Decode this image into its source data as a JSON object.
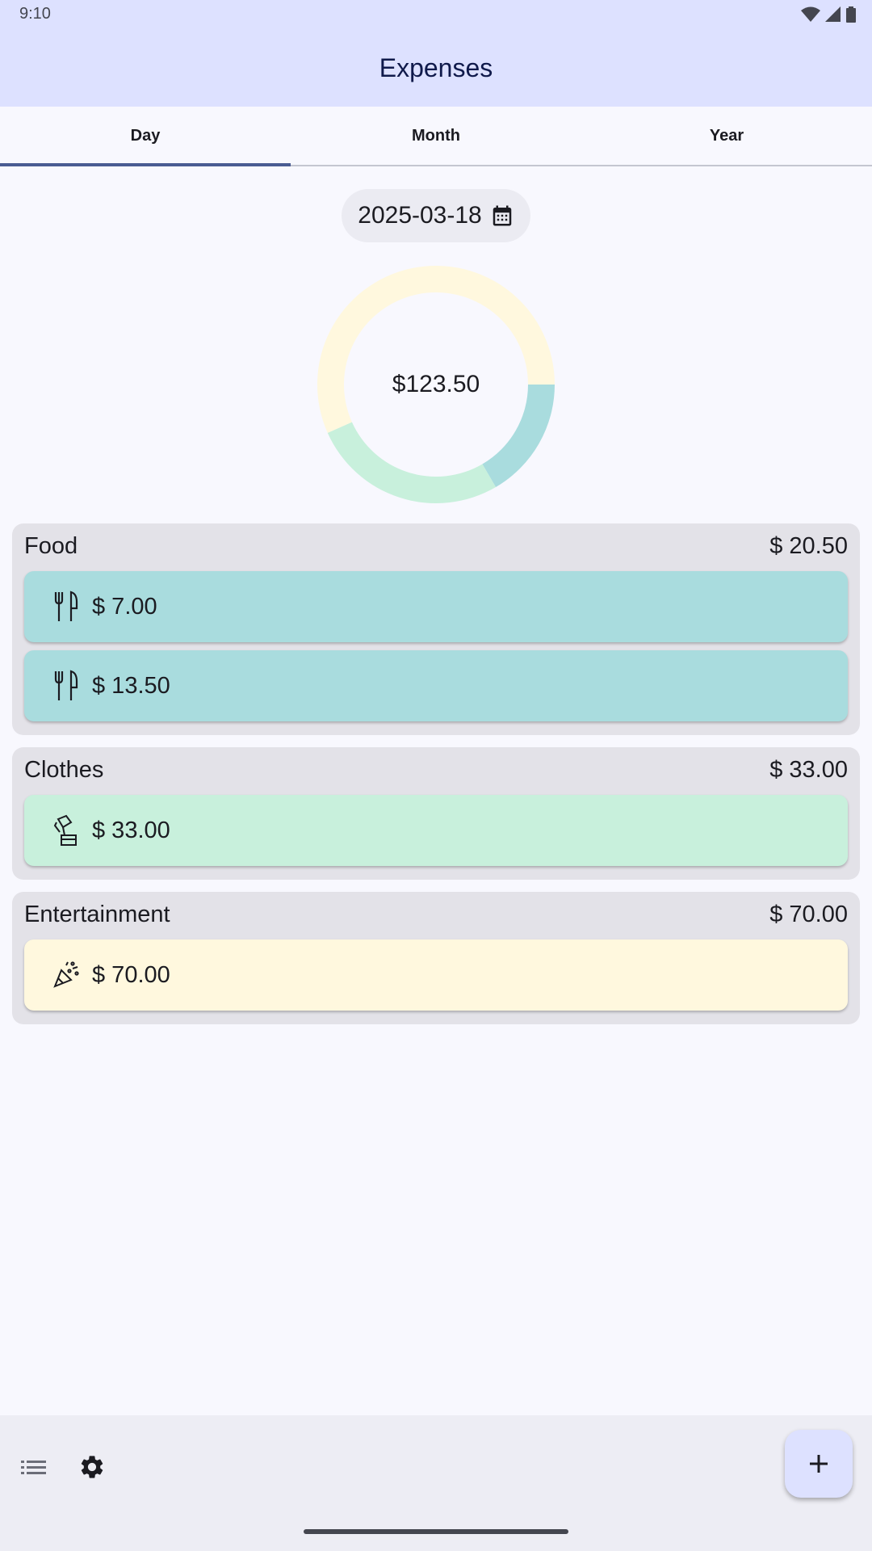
{
  "status_bar": {
    "time": "9:10",
    "icons": [
      "wifi-icon",
      "signal-icon",
      "battery-icon"
    ]
  },
  "app_bar": {
    "title": "Expenses"
  },
  "tabs": [
    {
      "label": "Day",
      "active": true
    },
    {
      "label": "Month",
      "active": false
    },
    {
      "label": "Year",
      "active": false
    }
  ],
  "date_picker": {
    "value": "2025-03-18",
    "icon": "calendar-icon"
  },
  "chart_data": {
    "type": "pie",
    "center_label": "$123.50",
    "slices": [
      {
        "name": "Food",
        "value": 20.5,
        "color": "#a9dcde"
      },
      {
        "name": "Clothes",
        "value": 33.0,
        "color": "#c8f0dc"
      },
      {
        "name": "Entertainment",
        "value": 70.0,
        "color": "#fff8de"
      }
    ]
  },
  "groups": [
    {
      "name": "Food",
      "total": "$ 20.50",
      "color": "#a9dcde",
      "icon": "fork-knife-icon",
      "items": [
        {
          "amount": "$ 7.00"
        },
        {
          "amount": "$ 13.50"
        }
      ]
    },
    {
      "name": "Clothes",
      "total": "$ 33.00",
      "color": "#c8f0dc",
      "icon": "clothes-iron-icon",
      "items": [
        {
          "amount": "$ 33.00"
        }
      ]
    },
    {
      "name": "Entertainment",
      "total": "$ 70.00",
      "color": "#fff8de",
      "icon": "party-popper-icon",
      "items": [
        {
          "amount": "$ 70.00"
        }
      ]
    }
  ],
  "bottom_bar": {
    "list_icon": "list-icon",
    "settings_icon": "gear-icon",
    "add_icon": "plus-icon"
  },
  "colors": {
    "app_bar_bg": "#dde1ff",
    "tab_indicator": "#4a5c92",
    "group_bg": "#e3e2e8"
  }
}
